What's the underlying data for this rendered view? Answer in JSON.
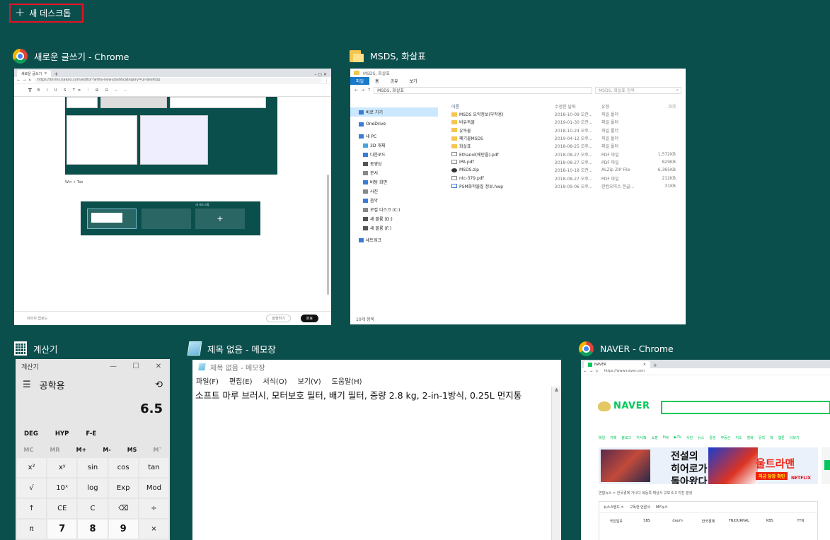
{
  "new_desktop": {
    "label": "새 데스크톱"
  },
  "windows": {
    "chrome_editor": {
      "title": "새로운 글쓰기 - Chrome",
      "tab": "새로운 글쓰기",
      "url": "https://terms.kakao.com/editor?write-new-post&category=ui-desktop",
      "caption": "Win + Tab",
      "shot_label": "새 데스크톱",
      "footer_text": "이미지 업로드",
      "footer_btn1": "발행하기",
      "footer_btn2": "완료"
    },
    "explorer": {
      "title": "MSDS, 화살표",
      "window_title": "MSDS, 화살표",
      "ribbon": [
        "파일",
        "홈",
        "공유",
        "보기"
      ],
      "address": "MSDS, 화살표",
      "search": "MSDS, 화살표 검색",
      "columns": [
        "이름",
        "수정한 날짜",
        "유형",
        "크기"
      ],
      "nav": [
        {
          "label": "바로 가기",
          "color": "#3a7bd5"
        },
        {
          "label": "OneDrive",
          "color": "#3a7bd5"
        },
        {
          "label": "내 PC",
          "color": "#3a7bd5"
        },
        {
          "label": "3D 개체",
          "color": "#4aa3df"
        },
        {
          "label": "다운로드",
          "color": "#3a7bd5"
        },
        {
          "label": "동영상",
          "color": "#555"
        },
        {
          "label": "문서",
          "color": "#888"
        },
        {
          "label": "바탕 화면",
          "color": "#3a7bd5"
        },
        {
          "label": "사진",
          "color": "#888"
        },
        {
          "label": "음악",
          "color": "#3a7bd5"
        },
        {
          "label": "로컬 디스크 (C:)",
          "color": "#888"
        },
        {
          "label": "새 볼륨 (D:)",
          "color": "#555"
        },
        {
          "label": "새 볼륨 (F:)",
          "color": "#555"
        },
        {
          "label": "네트워크",
          "color": "#3a7bd5"
        }
      ],
      "rows": [
        {
          "name": "MSDS 요약정보(부착용)",
          "date": "2018-10-09 오전...",
          "type": "파일 폴더",
          "size": "",
          "icon": "folder"
        },
        {
          "name": "비유독물",
          "date": "2019-01-30 오전...",
          "type": "파일 폴더",
          "size": "",
          "icon": "folder"
        },
        {
          "name": "유독물",
          "date": "2018-10-24 오후...",
          "type": "파일 폴더",
          "size": "",
          "icon": "folder"
        },
        {
          "name": "폐기물MSDS",
          "date": "2019-04-12 오후...",
          "type": "파일 폴더",
          "size": "",
          "icon": "folder"
        },
        {
          "name": "화살표",
          "date": "2018-08-25 오후...",
          "type": "파일 폴더",
          "size": "",
          "icon": "folder"
        },
        {
          "name": "Ethanol(에탄올).pdf",
          "date": "2018-08-27 오후...",
          "type": "PDF 파일",
          "size": "1,572KB",
          "icon": "pdf"
        },
        {
          "name": "IPA.pdf",
          "date": "2018-08-27 오후...",
          "type": "PDF 파일",
          "size": "829KB",
          "icon": "pdf"
        },
        {
          "name": "MSDS.zip",
          "date": "2018-10-18 오전...",
          "type": "ALZip ZIP File",
          "size": "6,365KB",
          "icon": "zip"
        },
        {
          "name": "ntc-379.pdf",
          "date": "2018-08-27 오후...",
          "type": "PDF 파일",
          "size": "212KB",
          "icon": "pdf"
        },
        {
          "name": "PSM화학물질 정보.hwp",
          "date": "2018-09-06 오후...",
          "type": "한컴오피스 한글...",
          "size": "31KB",
          "icon": "hwp"
        }
      ],
      "status": "10개 항목"
    },
    "calculator": {
      "title": "계산기",
      "window_title": "계산기",
      "mode": "공학용",
      "display": "6.5",
      "row1": [
        "DEG",
        "HYP",
        "F-E"
      ],
      "memory": [
        "MC",
        "MR",
        "M+",
        "M-",
        "MS",
        "M˅"
      ],
      "keys": [
        "x²",
        "xʸ",
        "sin",
        "cos",
        "tan",
        "√",
        "10ˣ",
        "log",
        "Exp",
        "Mod",
        "↑",
        "CE",
        "C",
        "⌫",
        "÷",
        "π",
        "7",
        "8",
        "9",
        "×"
      ]
    },
    "notepad": {
      "title": "제목 없음 - 메모장",
      "window_title": "제목 없음 - 메모장",
      "menu": [
        "파일(F)",
        "편집(E)",
        "서식(O)",
        "보기(V)",
        "도움말(H)"
      ],
      "content": "소프트 마루 브러시, 모터보호 필터, 배기 필터, 중량 2.8 kg, 2-in-1방식, 0.25L 먼지통"
    },
    "naver": {
      "title": "NAVER - Chrome",
      "tab": "NAVER",
      "url": "https://www.naver.com",
      "logo": "NAVER",
      "menu": [
        "메일",
        "카페",
        "블로그",
        "지식iN",
        "쇼핑",
        "Pay",
        "▶TV",
        "사전",
        "뉴스",
        "증권",
        "부동산",
        "지도",
        "영화",
        "뮤직",
        "책",
        "웹툰",
        "더보기"
      ],
      "banner_line1": "전설의",
      "banner_line2": "히어로가",
      "banner_line3": "돌아왔다!",
      "banner_title": "울트라맨",
      "banner_btn": "지금 당장 확인",
      "banner_brand": "NETFLIX",
      "news_ticker": "연합뉴스 > 한국경제 가나다 북동쪽 해상서 규모 6.3 지진 발생",
      "press_tabs": [
        "뉴스스탠드 >",
        "구독한 언론사",
        "MY뉴스"
      ],
      "press_logos": [
        "국민일보",
        "SBS",
        "daum",
        "한국경제",
        "FNJOURNAL",
        "KBS",
        "YTN"
      ]
    }
  }
}
